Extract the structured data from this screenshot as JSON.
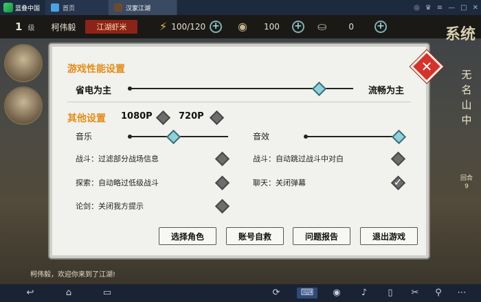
{
  "window": {
    "brand": "蓝叠中国",
    "tabs": [
      {
        "label": "首页"
      },
      {
        "label": "汉家江湖"
      }
    ]
  },
  "game": {
    "level_value": "1",
    "level_unit": "级",
    "player_name": "柯伟毅",
    "player_title": "江湖虾米",
    "stamina": "100/120",
    "coins": "100",
    "ingots": "0",
    "system_label": "系统",
    "right_labels": [
      "无",
      "名",
      "山",
      "中"
    ],
    "round_label": "回合",
    "round_value": "9",
    "chat_message": "柯伟毅，欢迎你来到了江湖!"
  },
  "settings": {
    "perf_title": "游戏性能设置",
    "power_saving": "省电为主",
    "smooth": "流畅为主",
    "perf_level": 0.85,
    "other_title": "其他设置",
    "res_1080": "1080P",
    "res_720": "720P",
    "music_label": "音乐",
    "music_level": 0.45,
    "sfx_label": "音效",
    "sfx_level": 0.95,
    "options": [
      {
        "label": "战斗：过滤部分战场信息",
        "checked": false
      },
      {
        "label": "战斗：自动跳过战斗中对白",
        "checked": false
      },
      {
        "label": "探索：自动略过低级战斗",
        "checked": false
      },
      {
        "label": "聊天：关闭弹幕",
        "checked": true
      },
      {
        "label": "论剑：关闭我方提示",
        "checked": false
      }
    ],
    "buttons": {
      "select_role": "选择角色",
      "account_rescue": "账号自救",
      "report": "问题报告",
      "exit": "退出游戏"
    }
  }
}
